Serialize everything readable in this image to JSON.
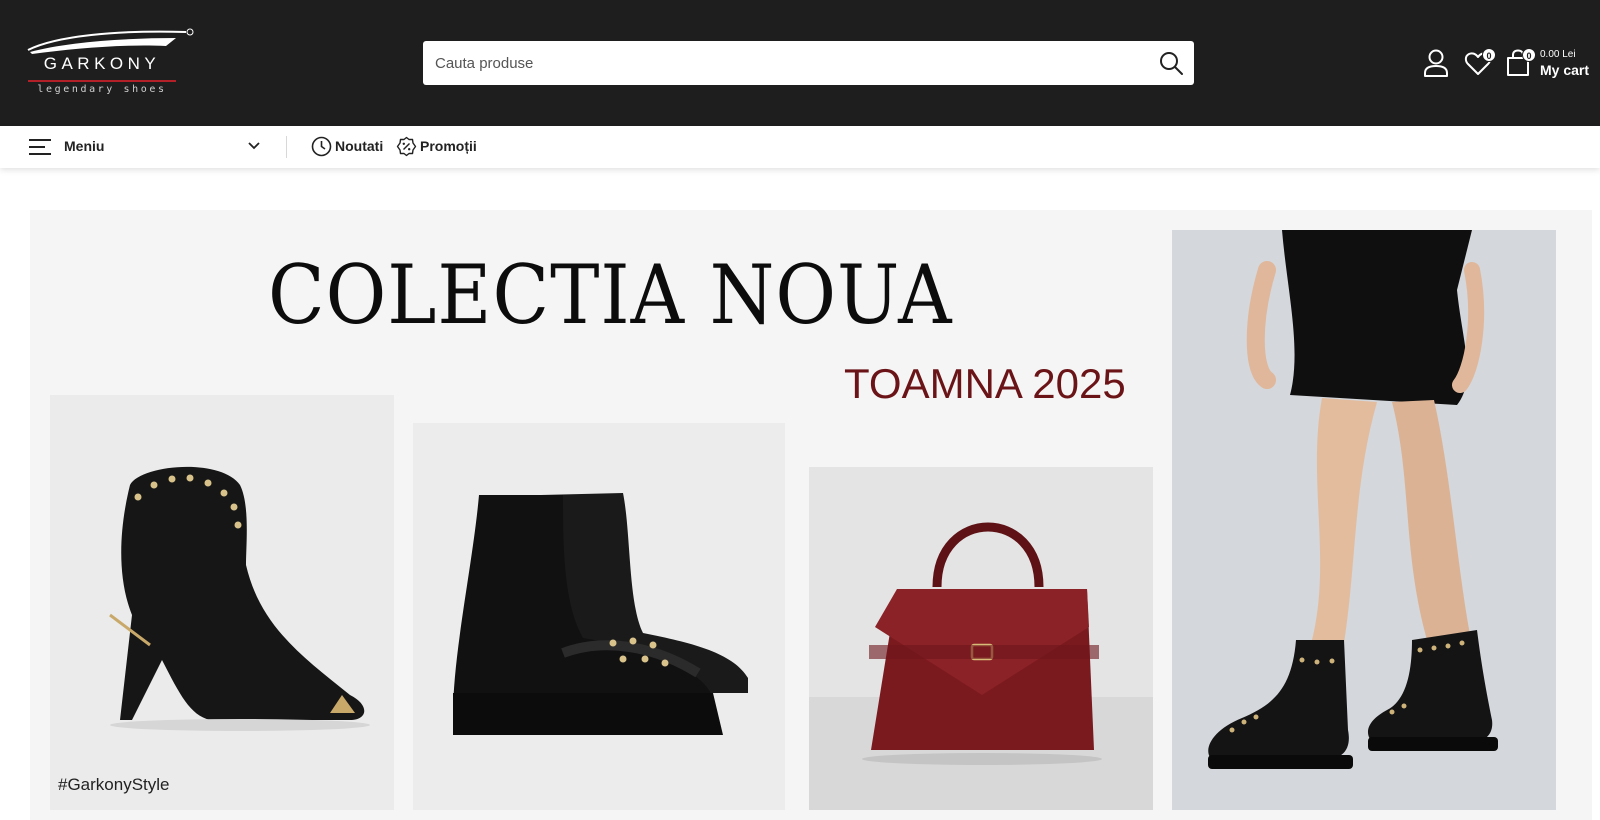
{
  "brand": {
    "name": "GARKONY",
    "tagline": "legendary shoes",
    "accent": "#b32028"
  },
  "search": {
    "placeholder": "Cauta produse",
    "button_icon": "search-icon"
  },
  "header": {
    "account_icon": "user-icon",
    "wishlist": {
      "icon": "heart-icon",
      "count": "0"
    },
    "cart": {
      "icon": "shopping-bag-icon",
      "count": "0",
      "amount": "0.00 Lei",
      "label": "My cart"
    }
  },
  "nav": {
    "menu_label": "Meniu",
    "links": [
      {
        "label": "Noutati",
        "icon": "clock-icon"
      },
      {
        "label": "Promoții",
        "icon": "percent-badge-icon"
      }
    ]
  },
  "banner": {
    "title": "COLECTIA NOUA",
    "subtitle": "TOAMNA 2025",
    "hashtag": "#GarkonyStyle",
    "title_color": "#0c0c0c",
    "subtitle_color": "#6b1418"
  },
  "colors": {
    "header_bg": "#1e1e1e",
    "bag": "#7a1a1f"
  }
}
